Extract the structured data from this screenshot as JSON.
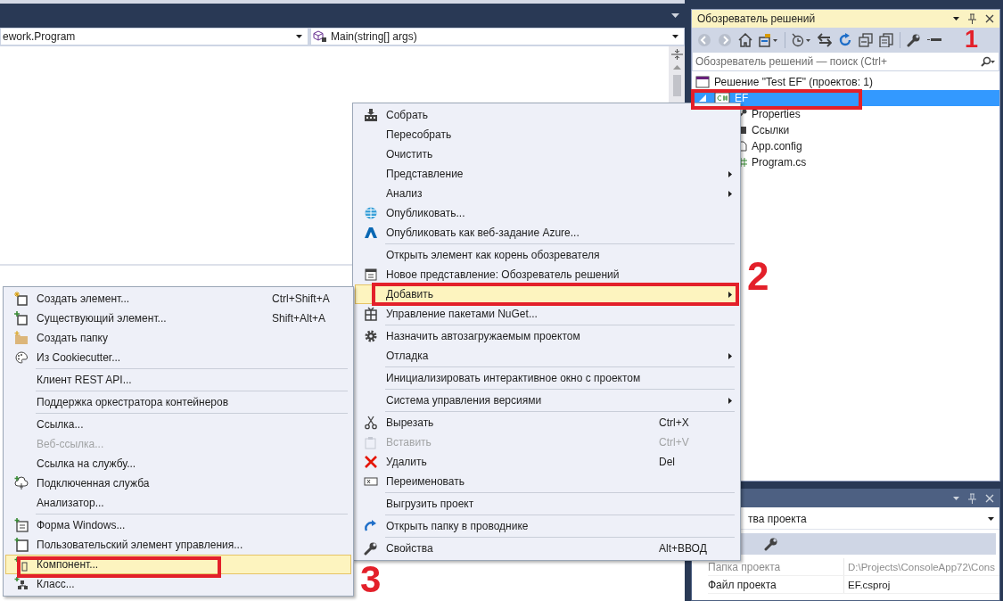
{
  "editor": {
    "type_selector": "ework.Program",
    "member_selector": "Main(string[] args)"
  },
  "solution_explorer": {
    "title": "Обозреватель решений",
    "search": {
      "placeholder": "Обозреватель решений — поиск (Ctrl+"
    },
    "tree": [
      {
        "label": "Решение \"Test EF\" (проектов: 1)",
        "selected": false,
        "children": [
          {
            "label": "EF",
            "selected": true,
            "expanded": true,
            "children": [
              {
                "label": "Properties",
                "selected": false
              },
              {
                "label": "Ссылки",
                "selected": false
              },
              {
                "label": "App.config",
                "selected": false
              },
              {
                "label": "Program.cs",
                "selected": false
              }
            ]
          }
        ]
      }
    ]
  },
  "properties": {
    "selector": "тва проекта",
    "rows": [
      {
        "name": "Папка проекта",
        "value": "D:\\Projects\\ConsoleApp72\\Cons",
        "disabled": true
      },
      {
        "name": "Файл проекта",
        "value": "EF.csproj",
        "disabled": false
      }
    ]
  },
  "context_menu": {
    "groups": [
      [
        {
          "label": "Собрать",
          "submenu": false,
          "disabled": false,
          "selected": false
        },
        {
          "label": "Пересобрать",
          "submenu": false,
          "disabled": false,
          "selected": false
        },
        {
          "label": "Очистить",
          "submenu": false,
          "disabled": false,
          "selected": false
        },
        {
          "label": "Представление",
          "submenu": true,
          "disabled": false,
          "selected": false
        },
        {
          "label": "Анализ",
          "submenu": true,
          "disabled": false,
          "selected": false
        },
        {
          "label": "Опубликовать...",
          "submenu": false,
          "disabled": false,
          "selected": false
        },
        {
          "label": "Опубликовать как веб-задание Azure...",
          "submenu": false,
          "disabled": false,
          "selected": false
        }
      ],
      [
        {
          "label": "Открыть элемент как корень обозревателя",
          "submenu": false,
          "disabled": false,
          "selected": false
        },
        {
          "label": "Новое представление: Обозреватель решений",
          "submenu": false,
          "disabled": false,
          "selected": false
        },
        {
          "label": "Добавить",
          "submenu": true,
          "disabled": false,
          "selected": true
        },
        {
          "label": "Управление пакетами NuGet...",
          "submenu": false,
          "disabled": false,
          "selected": false
        }
      ],
      [
        {
          "label": "Назначить автозагружаемым проектом",
          "submenu": false,
          "disabled": false,
          "selected": false
        },
        {
          "label": "Отладка",
          "submenu": true,
          "disabled": false,
          "selected": false
        }
      ],
      [
        {
          "label": "Инициализировать интерактивное окно с проектом",
          "submenu": false,
          "disabled": false,
          "selected": false
        }
      ],
      [
        {
          "label": "Система управления версиями",
          "submenu": true,
          "disabled": false,
          "selected": false
        }
      ],
      [
        {
          "label": "Вырезать",
          "shortcut": "Ctrl+X",
          "submenu": false,
          "disabled": false,
          "selected": false
        },
        {
          "label": "Вставить",
          "shortcut": "Ctrl+V",
          "submenu": false,
          "disabled": true,
          "selected": false
        },
        {
          "label": "Удалить",
          "shortcut": "Del",
          "submenu": false,
          "disabled": false,
          "selected": false
        },
        {
          "label": "Переименовать",
          "submenu": false,
          "disabled": false,
          "selected": false
        }
      ],
      [
        {
          "label": "Выгрузить проект",
          "submenu": false,
          "disabled": false,
          "selected": false
        }
      ],
      [
        {
          "label": "Открыть папку в проводнике",
          "submenu": false,
          "disabled": false,
          "selected": false
        }
      ],
      [
        {
          "label": "Свойства",
          "shortcut": "Alt+ВВОД",
          "submenu": false,
          "disabled": false,
          "selected": false
        }
      ]
    ]
  },
  "add_submenu": {
    "groups": [
      [
        {
          "label": "Создать элемент...",
          "shortcut": "Ctrl+Shift+A",
          "disabled": false,
          "selected": false
        },
        {
          "label": "Существующий элемент...",
          "shortcut": "Shift+Alt+A",
          "disabled": false,
          "selected": false
        },
        {
          "label": "Создать папку",
          "disabled": false,
          "selected": false
        },
        {
          "label": "Из Cookiecutter...",
          "disabled": false,
          "selected": false
        }
      ],
      [
        {
          "label": "Клиент REST API...",
          "disabled": false,
          "selected": false
        }
      ],
      [
        {
          "label": "Поддержка оркестратора контейнеров",
          "disabled": false,
          "selected": false
        }
      ],
      [
        {
          "label": "Ссылка...",
          "disabled": false,
          "selected": false
        },
        {
          "label": "Веб-ссылка...",
          "disabled": true,
          "selected": false
        },
        {
          "label": "Ссылка на службу...",
          "disabled": false,
          "selected": false
        },
        {
          "label": "Подключенная служба",
          "disabled": false,
          "selected": false
        },
        {
          "label": "Анализатор...",
          "disabled": false,
          "selected": false
        }
      ],
      [
        {
          "label": "Форма Windows...",
          "disabled": false,
          "selected": false
        },
        {
          "label": "Пользовательский элемент управления...",
          "disabled": false,
          "selected": false
        },
        {
          "label": "Компонент...",
          "disabled": false,
          "selected": true
        },
        {
          "label": "Класс...",
          "disabled": false,
          "selected": false
        }
      ]
    ]
  },
  "annotations": [
    {
      "label": "1"
    },
    {
      "label": "2"
    },
    {
      "label": "3"
    }
  ]
}
